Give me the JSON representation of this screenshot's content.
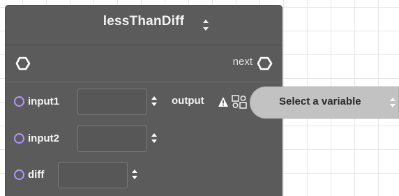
{
  "node": {
    "title": "lessThanDiff",
    "next_label": "next",
    "inputs": [
      {
        "label": "input1",
        "value": ""
      },
      {
        "label": "input2",
        "value": ""
      },
      {
        "label": "diff",
        "value": ""
      }
    ],
    "output_label": "output",
    "output_select": "Select a variable"
  },
  "icons": [
    "exec-in-icon",
    "exec-out-icon",
    "warning-icon",
    "variable-icon",
    "updown-caret-icon"
  ],
  "colors": {
    "node_bg": "#5b5b5b",
    "port_outline": "#b197fc",
    "select_bg": "#c2c2c2",
    "grid_line": "#e6e6e6"
  }
}
